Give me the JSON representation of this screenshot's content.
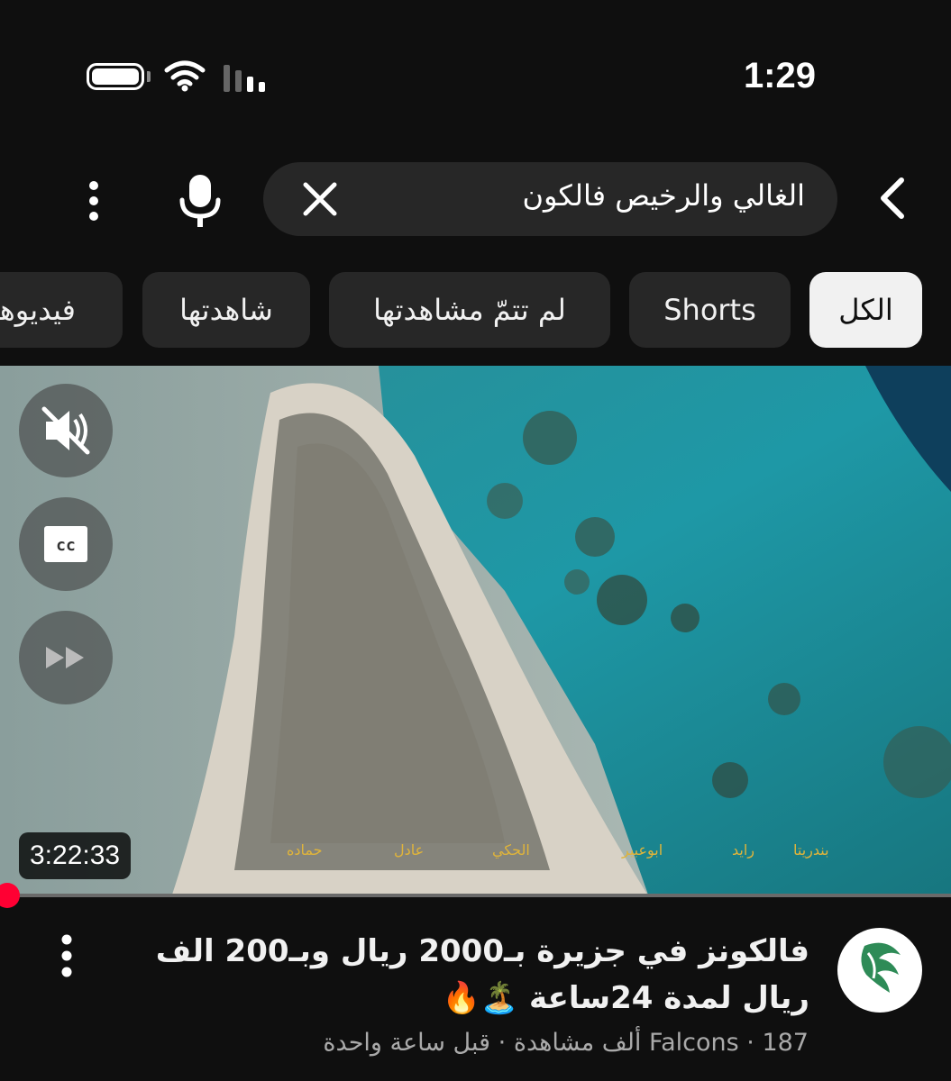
{
  "status_bar": {
    "time": "1:29"
  },
  "search": {
    "query": "الغالي والرخيص فالكون"
  },
  "chips": [
    {
      "label": "الكل",
      "active": true
    },
    {
      "label": "Shorts",
      "active": false
    },
    {
      "label": "لم تتمّ مشاهدتها",
      "active": false
    },
    {
      "label": "شاهدتها",
      "active": false
    },
    {
      "label": "فيديوهات",
      "active": false
    }
  ],
  "video": {
    "duration": "3:22:33",
    "progress": 0.0,
    "captions": [
      "بندريتا",
      "رايد",
      "ابوعبير",
      "الحكي",
      "عادل",
      "حماده"
    ]
  },
  "result": {
    "title": "فالكونز في جزيرة بـ2000 ريال وبـ200 الف ريال لمدة 24ساعة 🏝️🔥",
    "channel": "Falcons",
    "views": "187 ألف مشاهدة",
    "time_ago": "قبل ساعة واحدة",
    "separator": "·"
  },
  "colors": {
    "background": "#0f0f0f",
    "chip_bg": "#272727",
    "active_chip": "#f1f1f1",
    "progress": "#ff0033",
    "logo_green": "#2e8b57"
  },
  "icons": [
    "battery-icon",
    "wifi-icon",
    "signal-icon",
    "more-vert-icon",
    "mic-icon",
    "close-icon",
    "back-icon",
    "mute-icon",
    "cc-icon",
    "fast-forward-icon"
  ]
}
